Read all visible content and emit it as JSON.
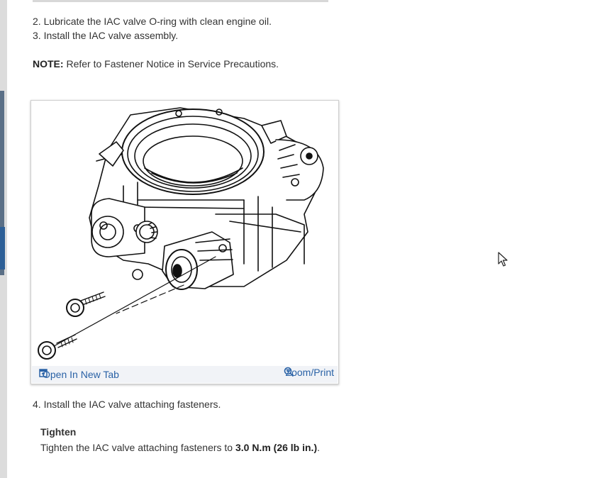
{
  "steps": {
    "step2": "2. Lubricate the IAC valve O-ring with clean engine oil.",
    "step3": "3. Install the IAC valve assembly.",
    "step4": "4. Install the IAC valve attaching fasteners."
  },
  "note": {
    "label": "NOTE:",
    "text": "Refer to Fastener Notice in Service Precautions."
  },
  "figure": {
    "open_label": "Open In New Tab",
    "zoom_label": "Zoom/Print",
    "open_icon": "open-new-tab-icon",
    "zoom_icon": "zoom-magnifier-icon"
  },
  "tighten": {
    "heading": "Tighten",
    "text_before": "Tighten the IAC valve attaching fasteners to ",
    "torque": "3.0 N.m (26 lb in.)",
    "text_after": "."
  },
  "colors": {
    "link": "#2a62a6",
    "text": "#333333",
    "toolbar_bg": "#f1f3f7"
  }
}
